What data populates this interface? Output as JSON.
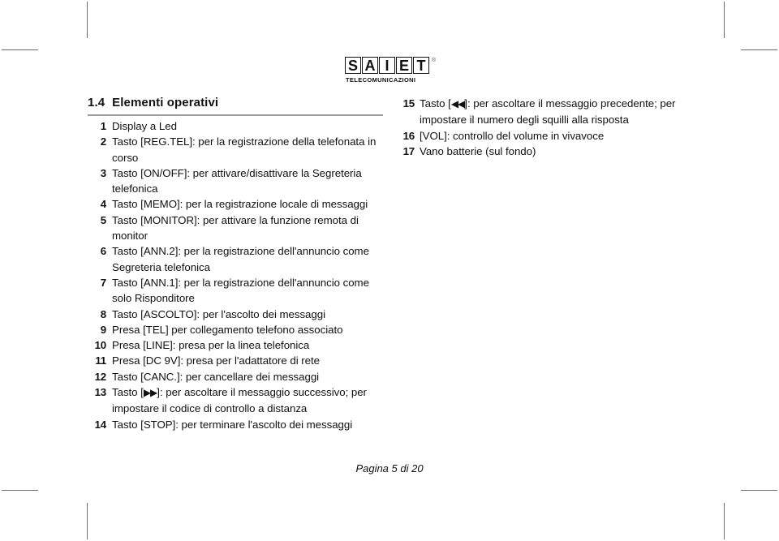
{
  "logo": {
    "name": "saiet-logo",
    "letters": [
      "S",
      "A",
      "I",
      "E",
      "T"
    ],
    "registered_mark": "®",
    "subtitle": "TELECOMUNICAZIONI"
  },
  "heading": {
    "number": "1.4",
    "title": "Elementi operativi"
  },
  "list_left": [
    {
      "num": "1",
      "text": "Display a Led"
    },
    {
      "num": "2",
      "text": "Tasto [REG.TEL]: per la registrazione della telefonata in corso"
    },
    {
      "num": "3",
      "text": "Tasto [ON/OFF]: per attivare/disattivare la Segreteria telefonica"
    },
    {
      "num": "4",
      "text": "Tasto [MEMO]: per la registrazione locale di messaggi"
    },
    {
      "num": "5",
      "text": "Tasto [MONITOR]: per attivare la funzione remota di monitor"
    },
    {
      "num": "6",
      "text": "Tasto [ANN.2]: per la registrazione dell'annuncio come Segreteria telefonica"
    },
    {
      "num": "7",
      "text": "Tasto [ANN.1]: per la registrazione dell'annuncio come solo Risponditore"
    },
    {
      "num": "8",
      "text": "Tasto [ASCOLTO]: per l'ascolto dei messaggi"
    },
    {
      "num": "9",
      "text": "Presa [TEL] per collegamento telefono associato"
    },
    {
      "num": "10",
      "text": "Presa [LINE]: presa per la linea telefonica"
    },
    {
      "num": "11",
      "text": "Presa [DC 9V]: presa per l'adattatore di rete"
    },
    {
      "num": "12",
      "text": "Tasto [CANC.]: per cancellare dei messaggi"
    },
    {
      "num": "13",
      "text": "Tasto [▶▶]: per ascoltare il messaggio successivo; per impostare il codice di controllo a distanza"
    },
    {
      "num": "14",
      "text": "Tasto [STOP]: per terminare l'ascolto dei messaggi"
    }
  ],
  "list_right": [
    {
      "num": "15",
      "text": "Tasto [◀◀]: per ascoltare il messaggio precedente; per impostare il numero degli squilli alla risposta"
    },
    {
      "num": "16",
      "text": "[VOL]: controllo del volume in vivavoce"
    },
    {
      "num": "17",
      "text": "Vano batterie (sul fondo)"
    }
  ],
  "footer": {
    "page_label": "Pagina 5 di 20"
  },
  "colors": {
    "text": "#111111",
    "rule": "#9a9a9a",
    "crop_mark": "#6b6b6b",
    "background": "#ffffff"
  }
}
